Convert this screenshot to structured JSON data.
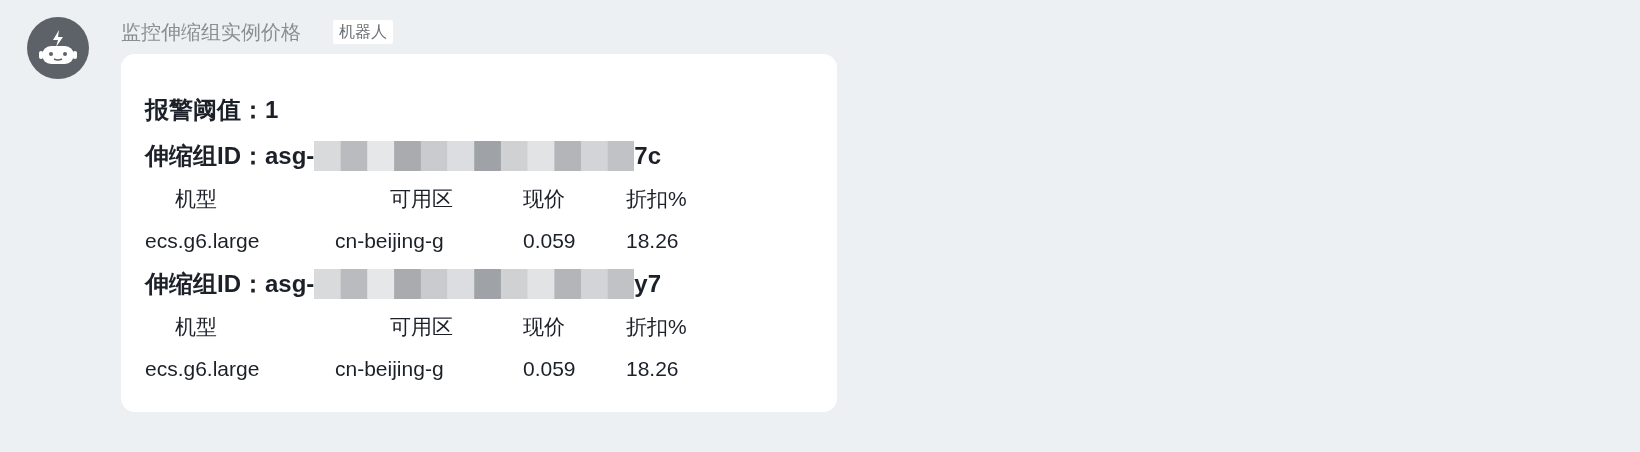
{
  "sender": {
    "name": "监控伸缩组实例价格",
    "badge": "机器人"
  },
  "message": {
    "threshold": "报警阈值：1",
    "groups": [
      {
        "label": "伸缩组ID：",
        "id_prefix": "asg-",
        "id_suffix": "7c",
        "headers": [
          "机型",
          "可用区",
          "现价",
          "折扣%"
        ],
        "rows": [
          [
            "ecs.g6.large",
            "cn-beijing-g",
            "0.059",
            "18.26"
          ]
        ]
      },
      {
        "label": "伸缩组ID：",
        "id_prefix": "asg-",
        "id_suffix": "y7",
        "headers": [
          "机型",
          "可用区",
          "现价",
          "折扣%"
        ],
        "rows": [
          [
            "ecs.g6.large",
            "cn-beijing-g",
            "0.059",
            "18.26"
          ]
        ]
      }
    ]
  }
}
